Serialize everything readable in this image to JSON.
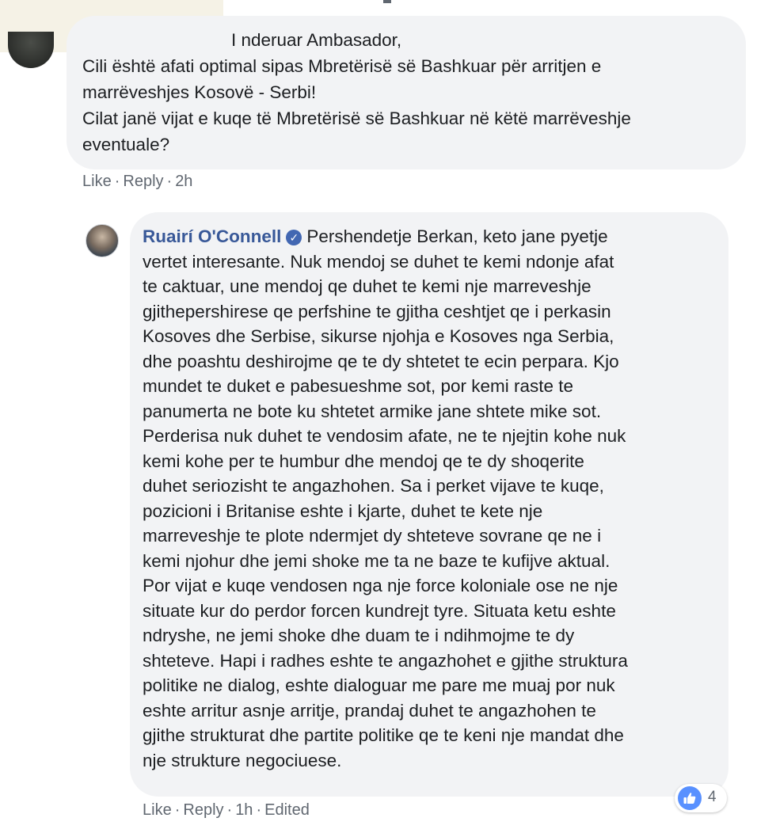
{
  "comment1": {
    "lines": [
      "I nderuar Ambasador,",
      "Cili është afati optimal sipas Mbretërisë së Bashkuar për arritjen e",
      "marrëveshjes Kosovë - Serbi!",
      "Cilat janë vijat e kuqe të Mbretërisë së Bashkuar në këtë marrëveshje",
      "eventuale?"
    ],
    "actions": {
      "like": "Like",
      "reply": "Reply",
      "time": "2h"
    }
  },
  "reply": {
    "author": "Ruairí O'Connell",
    "verified_icon": "verified-badge-icon",
    "first_line": "Pershendetje Berkan, keto jane pyetje",
    "lines": [
      "vertet interesante. Nuk mendoj se duhet te kemi ndonje afat",
      "te caktuar, une mendoj qe duhet te kemi nje marreveshje",
      "gjithepershirese qe perfshine te gjitha ceshtjet qe i perkasin",
      "Kosoves dhe Serbise, sikurse njohja e Kosoves nga Serbia,",
      "dhe poashtu deshirojme qe te dy shtetet te ecin perpara. Kjo",
      "mundet te duket e pabesueshme sot, por kemi raste te",
      "panumerta ne bote ku shtetet armike jane shtete mike sot.",
      "Perderisa nuk duhet te vendosim afate, ne te njejtin kohe nuk",
      "kemi kohe per te humbur dhe mendoj qe te dy shoqerite",
      "duhet seriozisht te angazhohen. Sa i perket vijave te kuqe,",
      "pozicioni i Britanise eshte i kjarte, duhet te kete nje",
      "marreveshje te plote ndermjet dy shteteve sovrane qe ne i",
      "kemi njohur dhe jemi shoke me ta ne baze te kufijve aktual.",
      "Por vijat e kuqe vendosen nga nje force koloniale ose ne nje",
      "situate kur do perdor forcen kundrejt tyre. Situata ketu eshte",
      "ndryshe, ne jemi shoke dhe duam te i ndihmojme te dy",
      "shteteve. Hapi i radhes eshte te angazhohet e gjithe struktura",
      "politike ne dialog, eshte dialoguar me pare me muaj por nuk",
      "eshte arritur asnje arritje, prandaj duhet te angazhohen te",
      "gjithe strukturat dhe partite politike qe te keni nje mandat dhe",
      "nje strukture negociuese."
    ],
    "actions": {
      "like": "Like",
      "reply": "Reply",
      "time": "1h",
      "edited": "Edited"
    },
    "reaction": {
      "icon": "thumbs-up-icon",
      "count": "4",
      "color": "#5890ff"
    }
  },
  "colors": {
    "link": "#385898",
    "bubble": "#f2f3f5",
    "meta": "#606770"
  }
}
